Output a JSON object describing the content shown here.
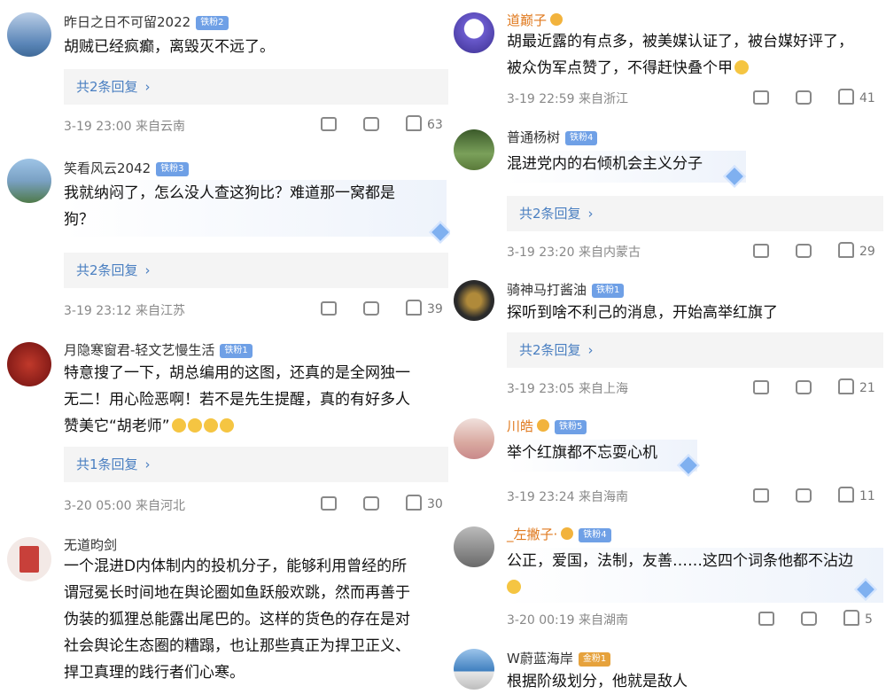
{
  "left": [
    {
      "user": "昨日之日不可留2022",
      "badge": "铁粉2",
      "lines": [
        "胡贼已经疯癫，离毁灭不远了。"
      ],
      "replies": "共2条回复",
      "time": "3-19 23:00",
      "loc": "来自云南",
      "likes": "63",
      "avatar_color": "#5b86b8"
    },
    {
      "user": "笑看风云2042",
      "badge": "铁粉3",
      "lines": [
        "我就纳闷了，怎么没人查这狗比？难道那一窝都是",
        "狗？"
      ],
      "replies": "共2条回复",
      "time": "3-19 23:12",
      "loc": "来自江苏",
      "likes": "39",
      "avatar_color": "#7aa1c4"
    },
    {
      "user": "月隐寒窗君-轻文艺慢生活",
      "badge": "铁粉1",
      "lines": [
        "特意搜了一下，胡总编用的这图，还真的是全网独一",
        "无二！用心险恶啊！若不是先生提醒，真的有好多人",
        "赞美它“胡老师”"
      ],
      "replies": "共1条回复",
      "time": "3-20 05:00",
      "loc": "来自河北",
      "likes": "30",
      "avatar_color": "#8a1a1a"
    },
    {
      "user": "无道昀剑",
      "badge": "",
      "lines": [
        "一个混进D内体制内的投机分子，能够利用曾经的所",
        "谓冠冕长时间地在舆论圈如鱼跃般欢跳，然而再善于",
        "伪装的狐狸总能露出尾巴的。这样的货色的存在是对",
        "社会舆论生态圈的糟蹋，也让那些真正为捍卫正义、",
        "捍卫真理的践行者们心寒。"
      ],
      "avatar_color": "#c8403a"
    }
  ],
  "right": [
    {
      "user": "道巅子",
      "badge": "",
      "lines": [
        "胡最近露的有点多，被美媒认证了，被台媒好评了，",
        "被众伪军点赞了，不得赶快叠个甲"
      ],
      "time": "3-19 22:59",
      "loc": "来自浙江",
      "likes": "41",
      "avatar_color": "#6a5acd"
    },
    {
      "user": "普通杨树",
      "badge": "铁粉4",
      "lines": [
        "混进党内的右倾机会主义分子"
      ],
      "replies": "共2条回复",
      "time": "3-19 23:20",
      "loc": "来自内蒙古",
      "likes": "29",
      "avatar_color": "#5a7a3a"
    },
    {
      "user": "骑神马打酱油",
      "badge": "铁粉1",
      "lines": [
        "探听到啥不利己的消息，开始高举红旗了"
      ],
      "replies": "共2条回复",
      "time": "3-19 23:05",
      "loc": "来自上海",
      "likes": "21",
      "avatar_color": "#2b2b2b"
    },
    {
      "user": "川皓",
      "badge": "铁粉5",
      "lines": [
        "举个红旗都不忘耍心机"
      ],
      "time": "3-19 23:24",
      "loc": "来自海南",
      "likes": "11",
      "avatar_color": "#d9a9a0"
    },
    {
      "user": "_左撇子·",
      "badge": "铁粉4",
      "lines": [
        "公正，爱国，法制，友善……这四个词条他都不沾边"
      ],
      "time": "3-20 00:19",
      "loc": "来自湖南",
      "likes": "5",
      "avatar_color": "#6a6a6a"
    },
    {
      "user": "W蔚蓝海岸",
      "badge": "金粉1",
      "lines": [
        "根据阶级划分，他就是敌人"
      ],
      "avatar_color": "#3f7fbf"
    }
  ],
  "colors": {
    "link": "#4a7fc1",
    "orange_name": "#e07a1f",
    "badge": "#6fa0e6"
  },
  "icons": [
    "share-icon",
    "comment-icon",
    "like-icon",
    "chevron-right-icon",
    "diamond-icon"
  ]
}
